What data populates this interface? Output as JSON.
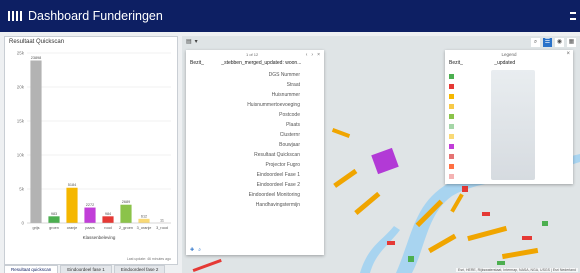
{
  "header": {
    "title": "Dashboard Funderingen"
  },
  "left_panel": {
    "title": "Resultaat Quickscan",
    "last_update": "Last update: 46 minutes ago",
    "tabs": [
      "Resultaat quickscan",
      "Eindoordeel fase 1",
      "Eindoordeel fase 2"
    ]
  },
  "chart_data": {
    "type": "bar",
    "categories": [
      "grijs",
      "groen",
      "oranje",
      "paars",
      "rood",
      "2_groen",
      "3_oranje",
      "3_rood"
    ],
    "values": [
      23898,
      983,
      5184,
      2272,
      984,
      2689,
      612,
      11
    ],
    "value_labels": [
      "23898",
      "983",
      "5184",
      "2272",
      "984",
      "2689",
      "612",
      "11"
    ],
    "colors": [
      "#b3b3b3",
      "#4caf50",
      "#f5b700",
      "#c13ed8",
      "#e53935",
      "#8bc34a",
      "#f9d976",
      "#f4b3b3"
    ],
    "xlabel": "Klassenbeleving",
    "ylabel": "",
    "ylim": [
      0,
      25000
    ],
    "yticks": [
      0,
      5000,
      10000,
      15000,
      20000,
      25000
    ],
    "ytick_labels": [
      "0",
      "5k",
      "10k",
      "15k",
      "20k",
      "25k"
    ],
    "grid": true
  },
  "map": {
    "toolbar_icons": [
      "layers-icon",
      "chevron-down-icon"
    ],
    "controls": [
      "search-icon",
      "legend-icon",
      "layers-icon",
      "basemap-icon"
    ],
    "attribution": "Esri, HERE, Rijkswaterstaat, Intermap, NASA, NGA, USGS | Esri Nederland"
  },
  "popup": {
    "pager": "1 of 12",
    "title_left": "Bezit_",
    "title_right": "_stebben_merged_updated: woon...",
    "fields": [
      "DGS Nummer",
      "Straat",
      "Huisnummer",
      "Huisnummertoevoeging",
      "Postcode",
      "Plaats",
      "Clusternr",
      "Bouwjaar",
      "Resultaat Quickscan",
      "Projector Fugro",
      "Eindoordeel Fase 1",
      "Eindoordeel Fase 2",
      "Eindoordeel Monitoring",
      "Handhavingstermijn"
    ]
  },
  "legend": {
    "heading": "Legend",
    "title_left": "Bezit_",
    "title_right": "_updated",
    "colors": [
      "#4caf50",
      "#e53935",
      "#f5b700",
      "#f7c948",
      "#8bc34a",
      "#a5d6a7",
      "#f9d976",
      "#c13ed8",
      "#e57373",
      "#ff7043",
      "#f4b3b3"
    ]
  }
}
